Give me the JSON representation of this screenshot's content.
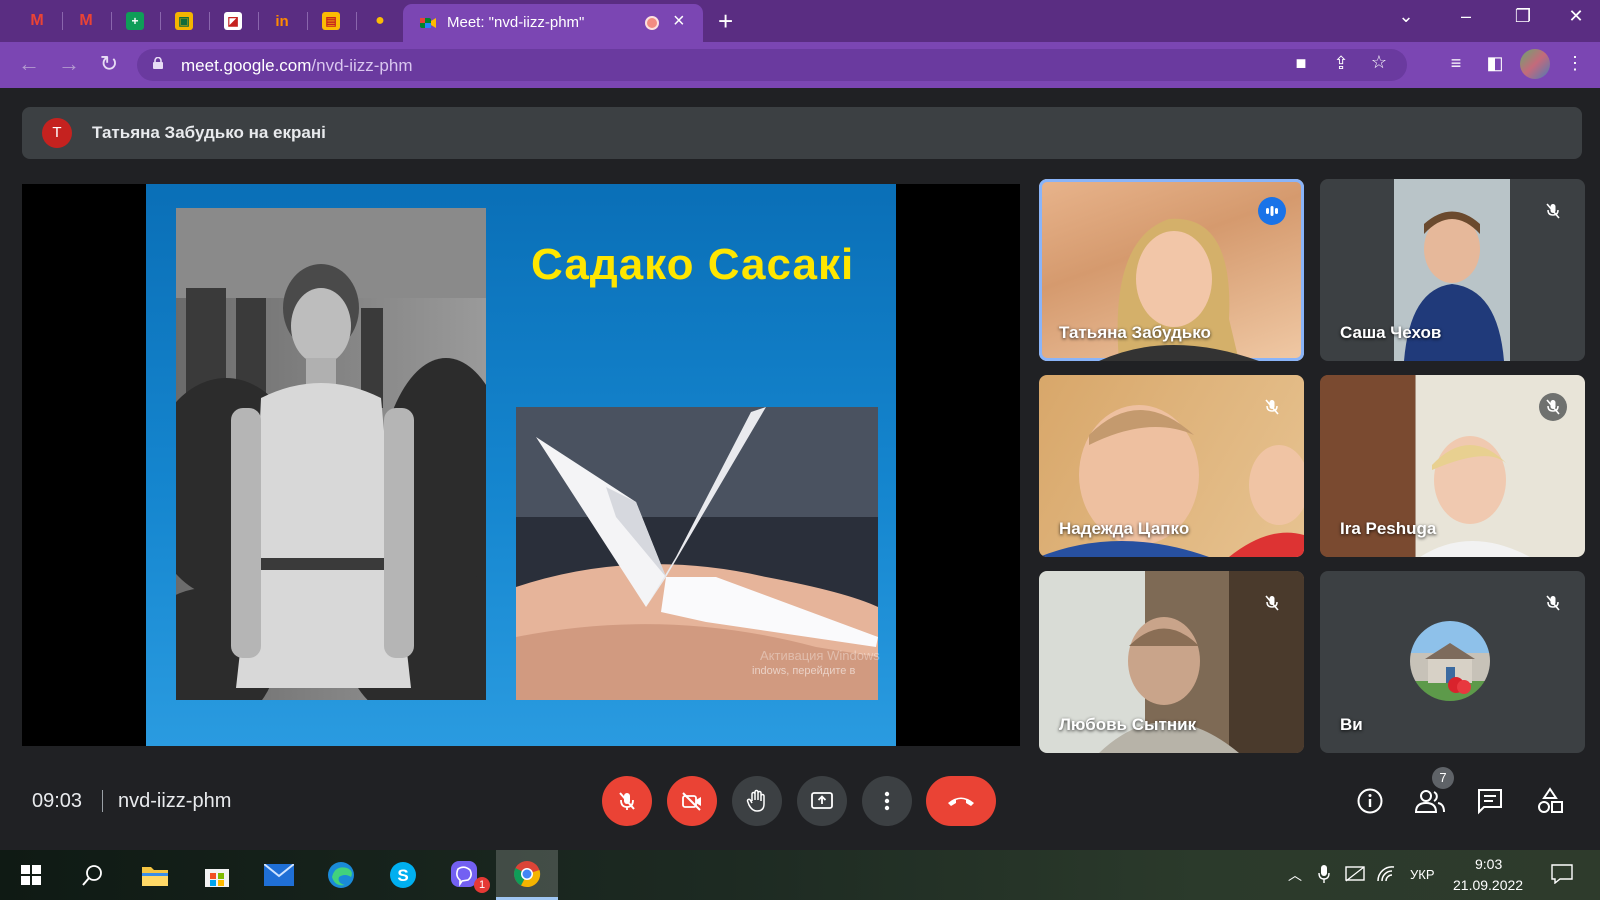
{
  "browser": {
    "pinned_tabs": [
      {
        "icon": "gmail-icon",
        "glyph": "M",
        "color": "#ea4335"
      },
      {
        "icon": "gmail-icon",
        "glyph": "M",
        "color": "#ea4335"
      },
      {
        "icon": "sheets-icon",
        "glyph": "+",
        "color": "#0f9d58"
      },
      {
        "icon": "classroom-icon",
        "glyph": "▣",
        "color": "#f4b400"
      },
      {
        "icon": "image-icon",
        "glyph": "◪",
        "color": "#ffffff"
      },
      {
        "icon": "invision-icon",
        "glyph": "in",
        "color": "#ff8a00"
      },
      {
        "icon": "folder-icon",
        "glyph": "▤",
        "color": "#fbbc04"
      },
      {
        "icon": "bulb-icon",
        "glyph": "●",
        "color": "#fbbc04"
      }
    ],
    "active_tab": {
      "title": "Meet: \"nvd-iizz-phm\""
    },
    "new_tab_label": "+",
    "url_domain": "meet.google.com",
    "url_path": "/nvd-iizz-phm"
  },
  "meet": {
    "presenter_avatar": "T",
    "presenter_text": "Татьяна Забудько на екрані",
    "slide": {
      "title": "Садако Сасакі",
      "watermark_line1": "Активация Windows",
      "watermark_line2": "indows, перейдите в"
    },
    "participants": [
      {
        "name": "Татьяна Забудько",
        "speaking": true
      },
      {
        "name": "Саша Чехов",
        "speaking": false
      },
      {
        "name": "Надежда Цапко",
        "speaking": false
      },
      {
        "name": "Ira Peshuga",
        "speaking": false
      },
      {
        "name": "Любовь Сытник",
        "speaking": false
      },
      {
        "name": "Ви",
        "speaking": false
      }
    ],
    "clock": "09:03",
    "meeting_code": "nvd-iizz-phm",
    "people_count": "7"
  },
  "taskbar": {
    "time": "9:03",
    "date": "21.09.2022",
    "language": "УКР",
    "viber_badge": "1"
  },
  "colors": {
    "chrome_frame": "#5a2d82",
    "chrome_toolbar": "#7b46b3",
    "meet_bg": "#202124",
    "danger": "#ea4335",
    "slide_title": "#ffe600"
  }
}
